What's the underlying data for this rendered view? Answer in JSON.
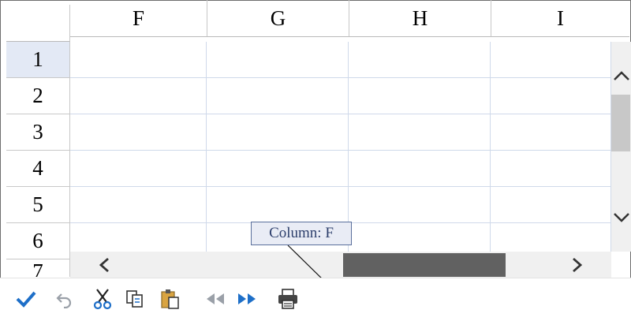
{
  "columns": [
    "F",
    "G",
    "H",
    "I"
  ],
  "rows": [
    "1",
    "2",
    "3",
    "4",
    "5",
    "6",
    "7"
  ],
  "selected_row": "1",
  "tooltip": {
    "text": "Column: F"
  },
  "scrollbars": {
    "vertical_up_icon": "chevron-up-icon",
    "vertical_down_icon": "chevron-down-icon",
    "horizontal_left_icon": "chevron-left-icon",
    "horizontal_right_icon": "chevron-right-icon"
  },
  "toolbar": {
    "icons": [
      "checkmark-icon",
      "undo-icon",
      "cut-icon",
      "copy-icon",
      "paste-icon",
      "previous-icon",
      "next-icon",
      "print-icon"
    ]
  },
  "colors": {
    "accent": "#1e6fc8",
    "grid_line": "#cfd9ea",
    "selected_row_header": "#e3e9f5",
    "tooltip_border": "#5a6f9c"
  }
}
